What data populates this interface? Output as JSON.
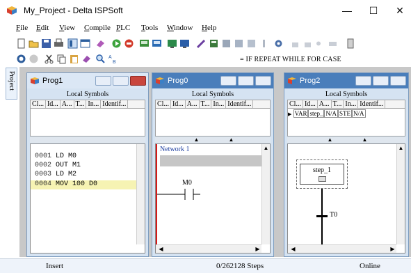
{
  "window": {
    "title": "My_Project - Delta ISPSoft",
    "minimize_glyph": "—",
    "maximize_glyph": "☐",
    "close_glyph": "✕"
  },
  "menu": [
    {
      "key": "F",
      "rest": "ile"
    },
    {
      "key": "E",
      "rest": "dit"
    },
    {
      "key": "V",
      "rest": "iew"
    },
    {
      "key": "C",
      "rest": "ompile"
    },
    {
      "key": "P",
      "rest": "LC"
    },
    {
      "key": "T",
      "rest": "ools"
    },
    {
      "key": "W",
      "rest": "indow"
    },
    {
      "key": "H",
      "rest": "elp"
    }
  ],
  "toolbar2": {
    "st_keywords": "= IF  REPEAT  WHILE  FOR  CASE"
  },
  "project_tab": "Project",
  "windows": [
    {
      "name": "Prog1",
      "active": true,
      "local_symbols": "Local Symbols",
      "columns": [
        "Cl...",
        "Id...",
        "A...",
        "T...",
        "In...",
        "Identif..."
      ],
      "code": [
        {
          "ln": "0001",
          "text": "LD M0"
        },
        {
          "ln": "0002",
          "text": "OUT M1"
        },
        {
          "ln": "0003",
          "text": "LD M2"
        },
        {
          "ln": "0004",
          "text": "MOV 100 D0"
        }
      ]
    },
    {
      "name": "Prog0",
      "active": false,
      "local_symbols": "Local Symbols",
      "columns": [
        "Cl...",
        "Id...",
        "A...",
        "T...",
        "In...",
        "Identif..."
      ],
      "network": "Network 1",
      "contact": "M0"
    },
    {
      "name": "Prog2",
      "active": false,
      "local_symbols": "Local Symbols",
      "columns": [
        "Cl...",
        "Id...",
        "A...",
        "T...",
        "In...",
        "Identif..."
      ],
      "var_row": [
        "VAR",
        "step_",
        "N/A",
        "STE",
        "N/A"
      ],
      "step": "step_1",
      "transition": "T0"
    }
  ],
  "status": {
    "mode": "Insert",
    "steps": "0/262128 Steps",
    "connection": "Online"
  },
  "colors": {
    "accent": "#4a7ebb",
    "selected_line": "#f6f3b3",
    "close_red": "#c9463d",
    "network_bar": "#d61818"
  }
}
